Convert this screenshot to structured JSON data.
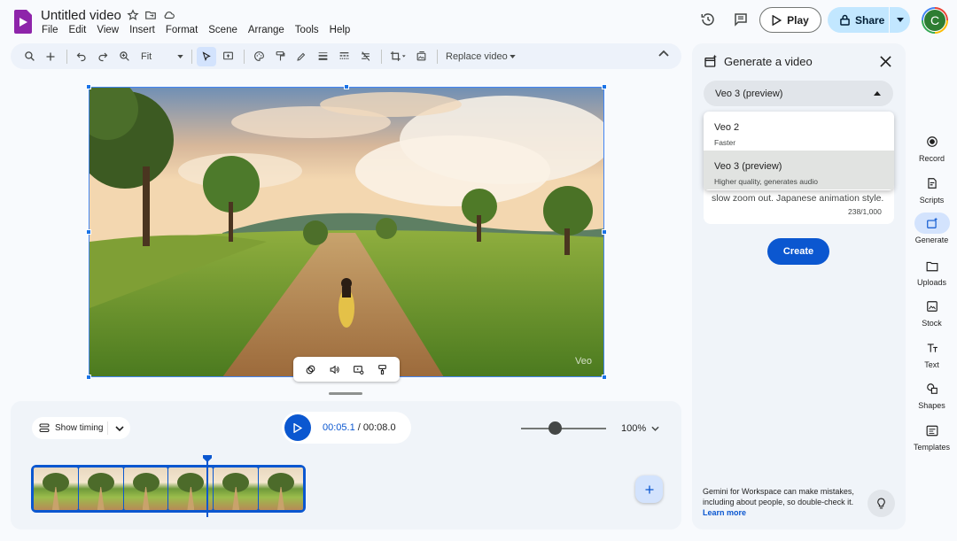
{
  "app": {
    "title": "Untitled video",
    "menus": [
      "File",
      "Edit",
      "View",
      "Insert",
      "Format",
      "Scene",
      "Arrange",
      "Tools",
      "Help"
    ],
    "play_label": "Play",
    "share_label": "Share",
    "avatar_initial": "C"
  },
  "toolbar": {
    "zoom_select": "Fit",
    "replace_video": "Replace video"
  },
  "canvas": {
    "watermark": "Veo"
  },
  "timeline": {
    "show_timing": "Show timing",
    "current_time": "00:05.1",
    "total_time": " / 00:08.0",
    "zoom_percent": "100%",
    "zoom_level": 0.4
  },
  "panel": {
    "title": "Generate a video",
    "selected_model": "Veo 3 (preview)",
    "options": [
      {
        "title": "Veo 2",
        "subtitle": "Faster"
      },
      {
        "title": "Veo 3 (preview)",
        "subtitle": "Higher quality, generates audio"
      }
    ],
    "prompt_visible": "slow zoom out. Japanese animation style.",
    "char_count": "238/1,000",
    "create_label": "Create",
    "disclaimer": "Gemini for Workspace can make mistakes, including about people, so double-check it.",
    "learn_more": "Learn more"
  },
  "rail": [
    {
      "label": "Record",
      "icon": "record-icon"
    },
    {
      "label": "Scripts",
      "icon": "scripts-icon"
    },
    {
      "label": "Generate",
      "icon": "generate-icon"
    },
    {
      "label": "Uploads",
      "icon": "uploads-icon"
    },
    {
      "label": "Stock",
      "icon": "stock-icon"
    },
    {
      "label": "Text",
      "icon": "text-icon"
    },
    {
      "label": "Shapes",
      "icon": "shapes-icon"
    },
    {
      "label": "Templates",
      "icon": "templates-icon"
    }
  ],
  "colors": {
    "accent": "#0b57d0",
    "share_bg": "#c2e7ff",
    "panel_bg": "#f0f4f9"
  }
}
